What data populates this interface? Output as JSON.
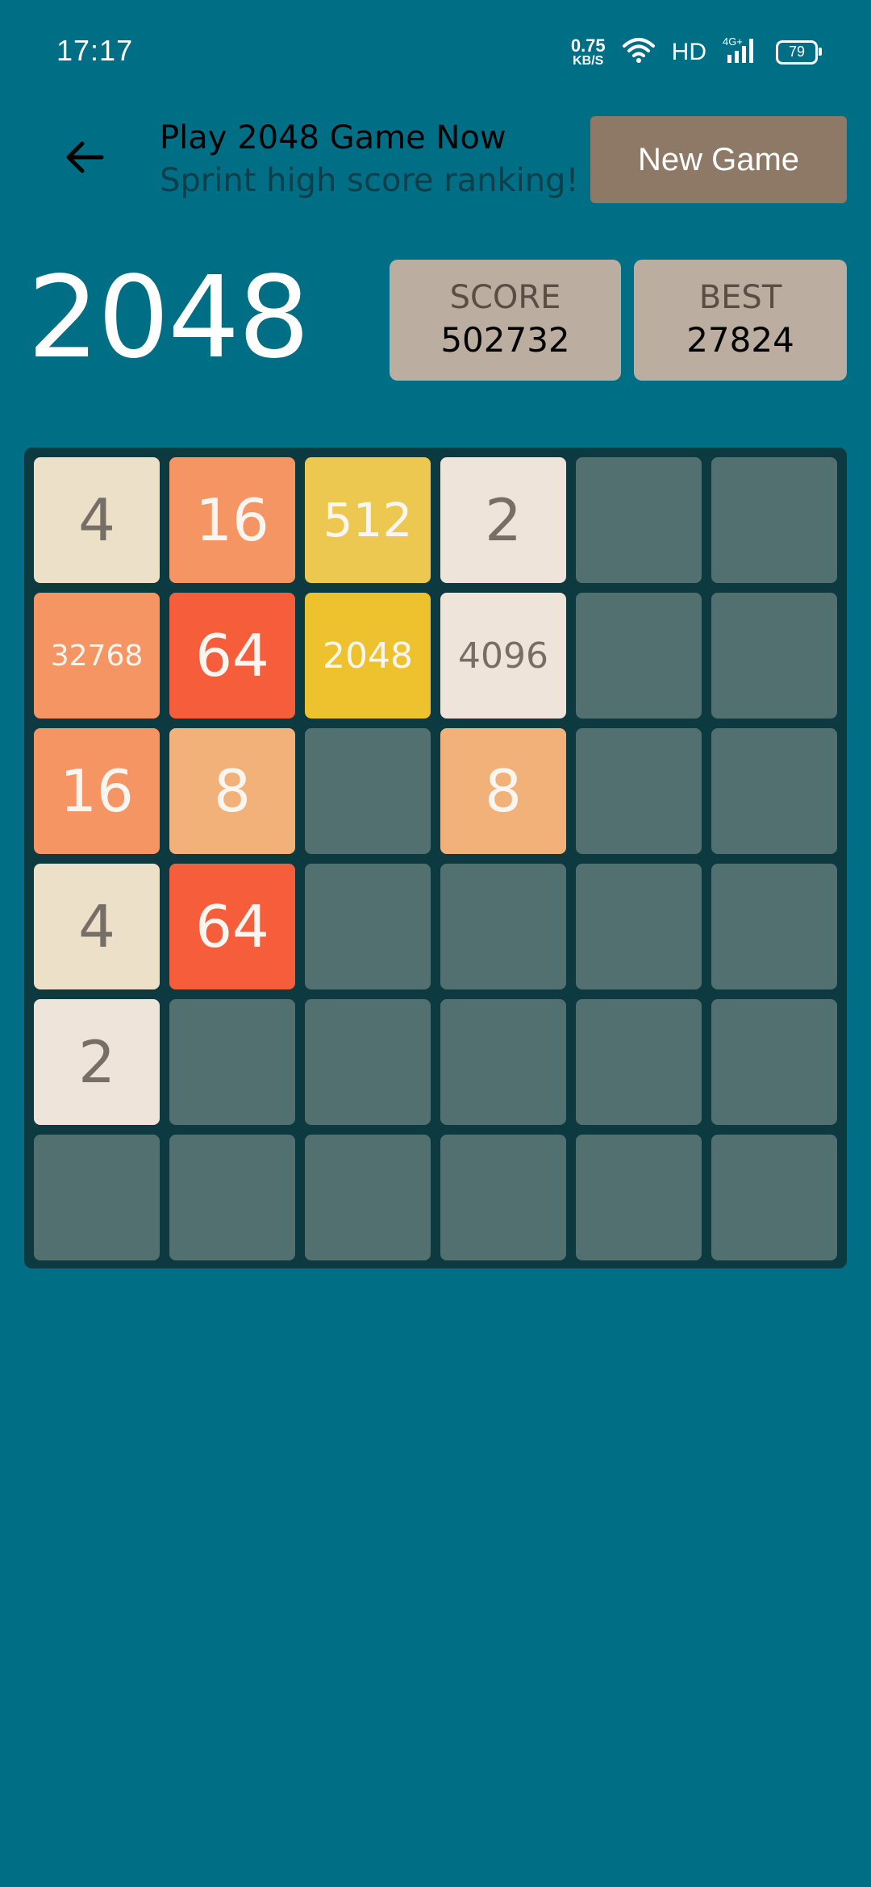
{
  "status_bar": {
    "time": "17:17",
    "net_speed_value": "0.75",
    "net_speed_unit": "KB/S",
    "hd": "HD",
    "network": "4G+",
    "battery": "79"
  },
  "header": {
    "title": "Play 2048 Game Now",
    "subtitle": "Sprint high score ranking!",
    "new_game_label": "New Game"
  },
  "logo": "2048",
  "scores": {
    "score_label": "SCORE",
    "score_value": "502732",
    "best_label": "BEST",
    "best_value": "27824"
  },
  "board": {
    "rows": [
      [
        "4",
        "16",
        "512",
        "2",
        "",
        ""
      ],
      [
        "32768",
        "64",
        "2048",
        "4096",
        "",
        ""
      ],
      [
        "16",
        "8",
        "",
        "8",
        "",
        ""
      ],
      [
        "4",
        "64",
        "",
        "",
        "",
        ""
      ],
      [
        "2",
        "",
        "",
        "",
        "",
        ""
      ],
      [
        "",
        "",
        "",
        "",
        "",
        ""
      ]
    ]
  },
  "colors": {
    "background": "#006E85",
    "board": "#0D3A40",
    "empty_cell": "#537071",
    "new_game_button": "#8D7966",
    "score_box": "#BBADA0"
  }
}
